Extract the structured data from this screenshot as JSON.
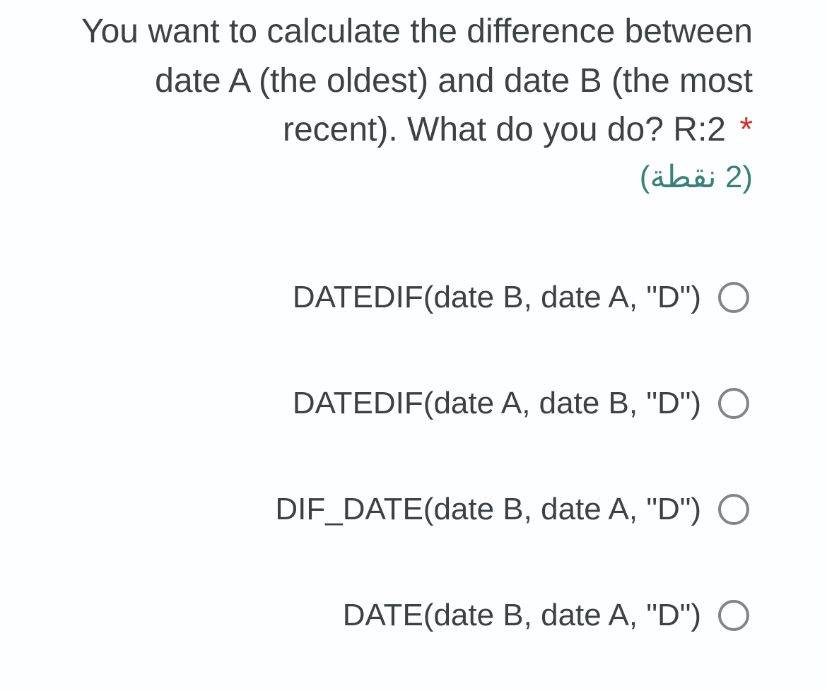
{
  "question": {
    "text": "You want to calculate the difference between date A (the oldest) and date B (the most recent). What do you do? R:2",
    "required_marker": "*",
    "points_label": "(2 نقطة)"
  },
  "options": [
    {
      "label": "DATEDIF(date B, date A, \"D\")"
    },
    {
      "label": "DATEDIF(date A, date B, \"D\")"
    },
    {
      "label": "DIF_DATE(date B, date A, \"D\")"
    },
    {
      "label": "DATE(date B, date A, \"D\")"
    }
  ]
}
